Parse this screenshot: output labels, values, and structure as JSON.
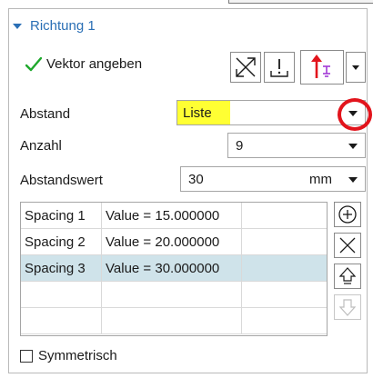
{
  "section": {
    "title": "Richtung 1",
    "icon": "chevron-down-icon"
  },
  "vector_row": {
    "label": "Vektor angeben",
    "status_icon": "checkmark-icon",
    "status_color": "#1ea82c",
    "tools": [
      "cross-arrows-icon",
      "exclamation-bracket-icon",
      "arrow-up-flip-icon",
      "dropdown-arrow-icon"
    ]
  },
  "abstand": {
    "label": "Abstand",
    "value": "Liste",
    "highlight_color": "#ffff33",
    "annotation_color": "#e2141c"
  },
  "anzahl": {
    "label": "Anzahl",
    "value": "9"
  },
  "abstandswert": {
    "label": "Abstandswert",
    "value": "30",
    "unit": "mm"
  },
  "spacing_table": {
    "rows": [
      {
        "name": "Spacing 1",
        "value": "Value = 15.000000",
        "extra": "",
        "selected": false
      },
      {
        "name": "Spacing 2",
        "value": "Value = 20.000000",
        "extra": "",
        "selected": false
      },
      {
        "name": "Spacing 3",
        "value": "Value = 30.000000",
        "extra": "",
        "selected": true
      },
      {
        "name": "",
        "value": "",
        "extra": "",
        "selected": false
      },
      {
        "name": "",
        "value": "",
        "extra": "",
        "selected": false
      }
    ],
    "side_buttons": [
      "add-icon",
      "delete-icon",
      "move-up-icon",
      "move-down-icon"
    ]
  },
  "symmetrisch": {
    "label": "Symmetrisch",
    "checked": false
  },
  "colors": {
    "accent": "#2a6fb5",
    "selected_row": "#cfe3ea",
    "border": "#a5a5a5"
  }
}
